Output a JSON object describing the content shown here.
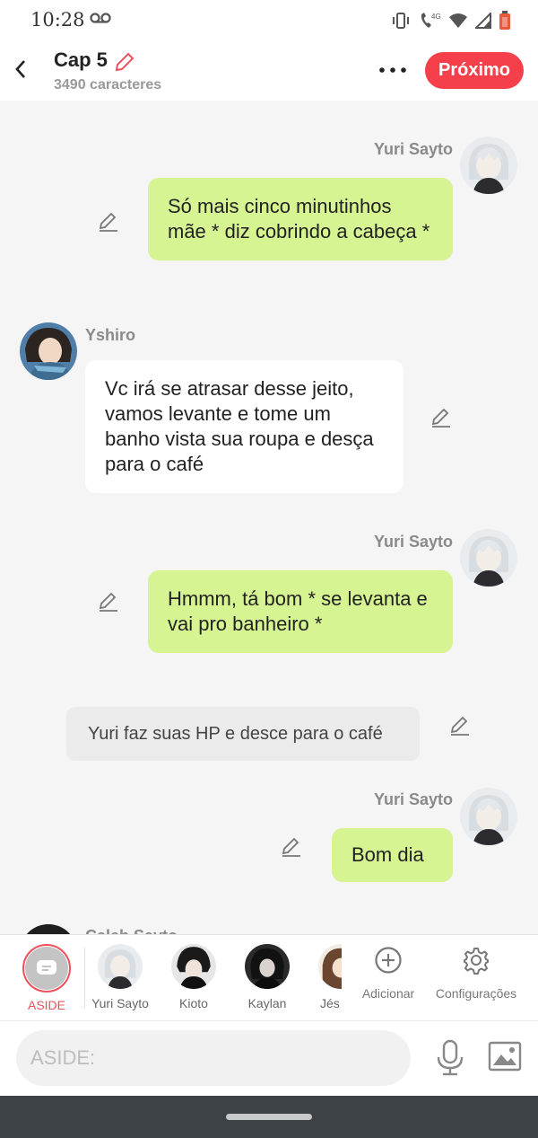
{
  "status_bar": {
    "time": "10:28",
    "network": "4G"
  },
  "header": {
    "title": "Cap 5",
    "subtitle": "3490 caracteres",
    "next_button": "Próximo"
  },
  "messages": [
    {
      "speaker": "Yuri Sayto",
      "side": "right",
      "text": "Só mais cinco minutinhos mãe * diz cobrindo a cabeça *"
    },
    {
      "speaker": "Yshiro",
      "side": "left",
      "text": "Vc irá se atrasar desse jeito, vamos levante e tome um banho vista sua roupa e desça para o café"
    },
    {
      "speaker": "Yuri Sayto",
      "side": "right",
      "text": "Hmmm, tá bom * se levanta e vai pro banheiro *"
    },
    {
      "speaker": "",
      "side": "center",
      "text": "Yuri faz suas HP e desce para o café"
    },
    {
      "speaker": "Yuri Sayto",
      "side": "right",
      "text": "Bom dia"
    },
    {
      "speaker": "Caleb Sayto",
      "side": "left",
      "text": ""
    }
  ],
  "character_bar": {
    "aside": "ASIDE",
    "characters": [
      "Yuri Sayto",
      "Kioto",
      "Kaylan",
      "Jés"
    ],
    "add_label": "Adicionar",
    "settings_label": "Configurações"
  },
  "input": {
    "placeholder": "ASIDE:"
  },
  "colors": {
    "accent": "#f5404c",
    "bubble_green": "#d6f492",
    "bubble_white": "#ffffff",
    "narration": "#ebebeb"
  }
}
